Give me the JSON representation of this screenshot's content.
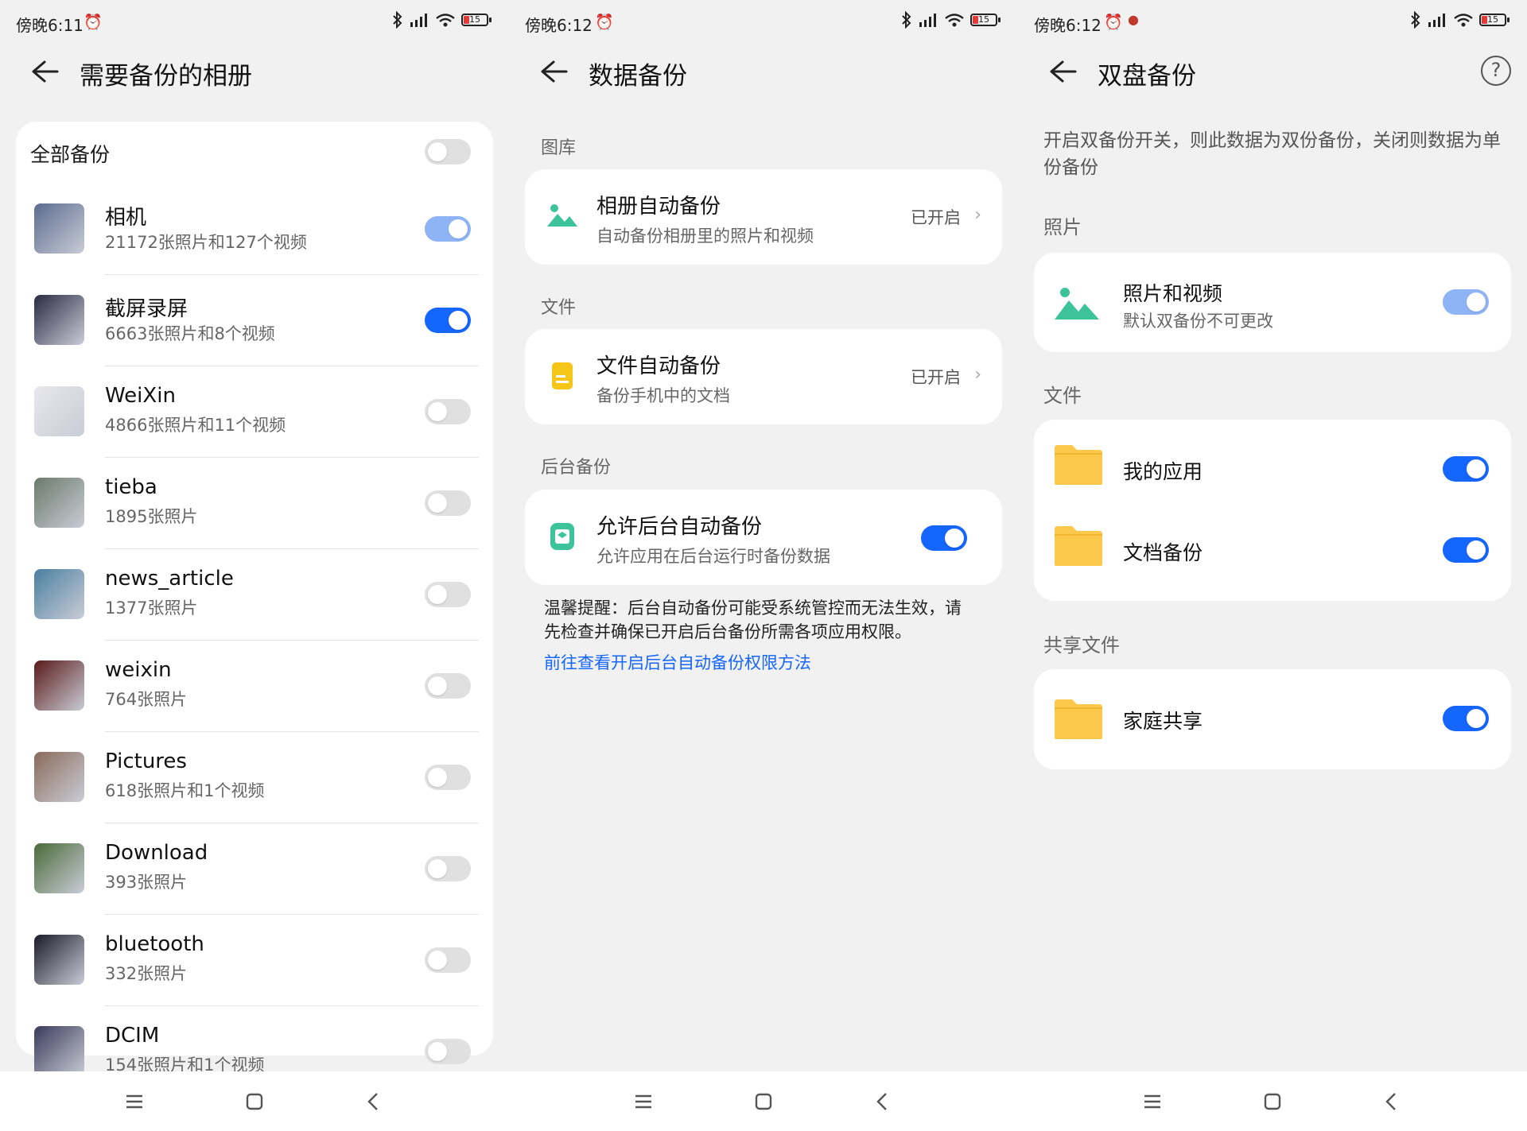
{
  "screen1": {
    "status": {
      "time": "傍晚6:11",
      "battery": "15"
    },
    "title": "需要备份的相册",
    "all_backup_label": "全部备份",
    "albums": [
      {
        "name": "相机",
        "count": "21172张照片和127个视频",
        "toggle": "on-dim"
      },
      {
        "name": "截屏录屏",
        "count": "6663张照片和8个视频",
        "toggle": "on"
      },
      {
        "name": "WeiXin",
        "count": "4866张照片和11个视频",
        "toggle": "off"
      },
      {
        "name": "tieba",
        "count": "1895张照片",
        "toggle": "off"
      },
      {
        "name": "news_article",
        "count": "1377张照片",
        "toggle": "off"
      },
      {
        "name": "weixin",
        "count": "764张照片",
        "toggle": "off"
      },
      {
        "name": "Pictures",
        "count": "618张照片和1个视频",
        "toggle": "off"
      },
      {
        "name": "Download",
        "count": "393张照片",
        "toggle": "off"
      },
      {
        "name": "bluetooth",
        "count": "332张照片",
        "toggle": "off"
      },
      {
        "name": "DCIM",
        "count": "154张照片和1个视频",
        "toggle": "off"
      }
    ]
  },
  "screen2": {
    "status": {
      "time": "傍晚6:12",
      "battery": "15"
    },
    "title": "数据备份",
    "sections": {
      "gallery": "图库",
      "files": "文件",
      "background": "后台备份"
    },
    "album_backup": {
      "title": "相册自动备份",
      "subtitle": "自动备份相册里的照片和视频",
      "state": "已开启"
    },
    "file_backup": {
      "title": "文件自动备份",
      "subtitle": "备份手机中的文档",
      "state": "已开启"
    },
    "bg_backup": {
      "title": "允许后台自动备份",
      "subtitle": "允许应用在后台运行时备份数据"
    },
    "tip_line1": "温馨提醒：后台自动备份可能受系统管控而无法生效，请",
    "tip_line2": "先检查并确保已开启后台备份所需各项应用权限。",
    "tip_link": "前往查看开启后台自动备份权限方法"
  },
  "screen3": {
    "status": {
      "time": "傍晚6:12",
      "battery": "15"
    },
    "title": "双盘备份",
    "help": "?",
    "description": "开启双备份开关，则此数据为双份备份，关闭则数据为单份备份",
    "sections": {
      "photos": "照片",
      "files": "文件",
      "shared": "共享文件"
    },
    "photos_row": {
      "title": "照片和视频",
      "subtitle": "默认双备份不可更改"
    },
    "my_apps": "我的应用",
    "doc_backup": "文档备份",
    "family_share": "家庭共享"
  },
  "colors": {
    "accent": "#1565ff",
    "toggle_dim": "#8fb4f6",
    "background": "#f1f1f1",
    "card": "#ffffff",
    "folder": "#fcc94d",
    "gallery_icon": "#3cc39a",
    "file_icon": "#f5c518"
  }
}
